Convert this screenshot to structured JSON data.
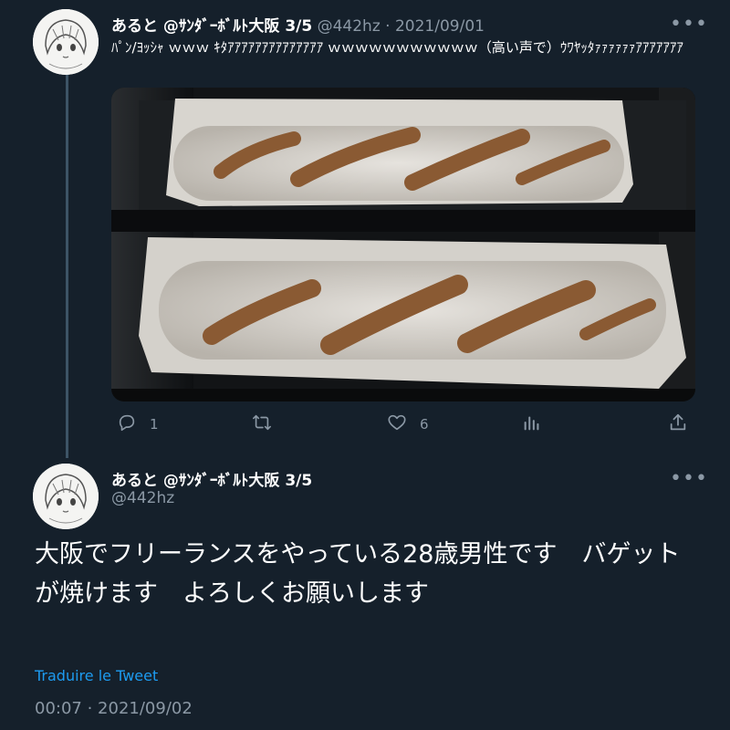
{
  "tweet1": {
    "display_name": "あると @ｻﾝﾀﾞｰﾎﾞﾙﾄ大阪 3/5",
    "handle": "@442hz",
    "separator": " · ",
    "date": "2021/09/01",
    "more_label": "•••",
    "text": "ﾊﾟﾝ/ﾖｯｼｬ ｗｗｗ ｷﾀｱｱｱｱｱｱｱｱｱｱｱｱｱｱ ｗｗｗｗｗｗｗｗｗｗｗ（高い声で）ｳﾜﾔｯﾀｧｧｧｧｧｧｱｱｱｱｱｱｱ",
    "reply_count": "1",
    "retweet_count": "",
    "like_count": "6",
    "icons": [
      "reply-icon",
      "retweet-icon",
      "like-icon",
      "analytics-icon",
      "share-icon"
    ]
  },
  "tweet2": {
    "display_name": "あると @ｻﾝﾀﾞｰﾎﾞﾙﾄ大阪 3/5",
    "handle": "@442hz",
    "more_label": "•••",
    "text": "大阪でフリーランスをやっている28歳男性です　バゲットが焼けます　よろしくお願いします",
    "translate_label": "Traduire le Tweet",
    "timestamp": "00:07 · 2021/09/02"
  },
  "colors": {
    "background": "#15202b",
    "secondary_text": "#8b98a5",
    "link": "#1d9bf0",
    "thread_line": "#3d5466"
  }
}
